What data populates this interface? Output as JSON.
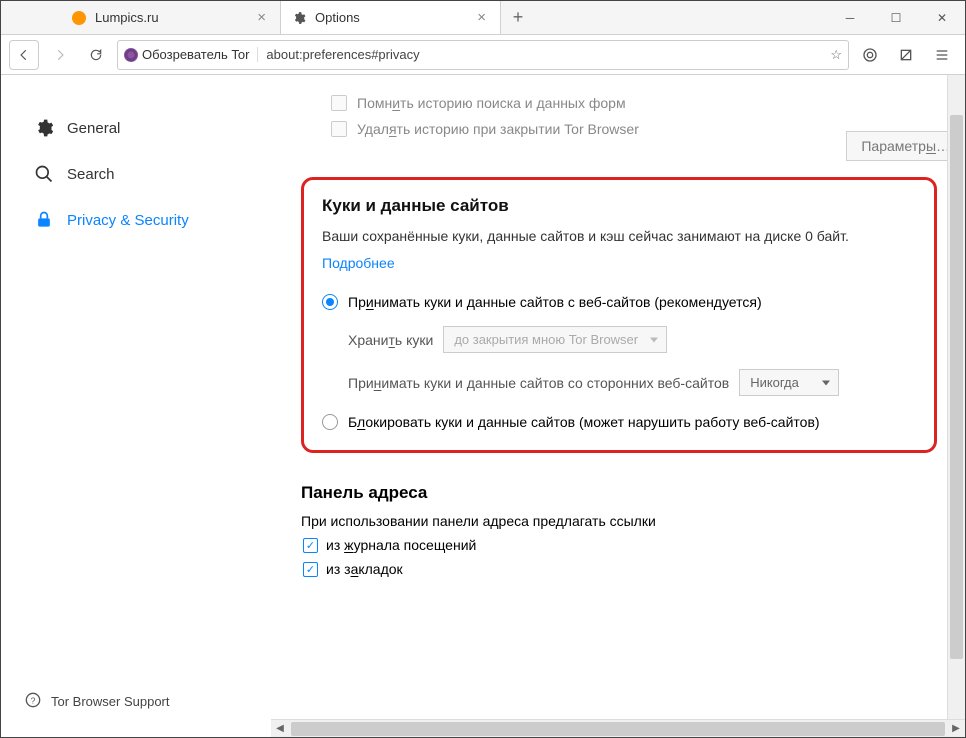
{
  "tabs": [
    {
      "title": "Lumpics.ru"
    },
    {
      "title": "Options"
    }
  ],
  "url": {
    "identity_label": "Обозреватель Tor",
    "address": "about:preferences#privacy"
  },
  "sidebar": {
    "general": "General",
    "search": "Search",
    "privacy": "Privacy & Security"
  },
  "support": "Tor Browser Support",
  "history": {
    "remember": "Помнить историю поиска и данных форм",
    "clear_on_close": "Удалять историю при закрытии Tor Browser",
    "params_btn": "Параметры"
  },
  "cookies": {
    "title": "Куки и данные сайтов",
    "desc": "Ваши сохранённые куки, данные сайтов и кэш сейчас занимают на диске 0 байт.",
    "learn_more": "Подробнее",
    "accept": "Принимать куки и данные сайтов с веб-сайтов (рекомендуется)",
    "keep_label": "Хранить куки",
    "keep_value": "до закрытия мною Tor Browser",
    "third_party_label": "Принимать куки и данные сайтов со сторонних веб-сайтов",
    "third_party_value": "Никогда",
    "block": "Блокировать куки и данные сайтов (может нарушить работу веб-сайтов)"
  },
  "addressbar": {
    "title": "Панель адреса",
    "desc": "При использовании панели адреса предлагать ссылки",
    "history": "из журнала посещений",
    "bookmarks": "из закладок"
  }
}
